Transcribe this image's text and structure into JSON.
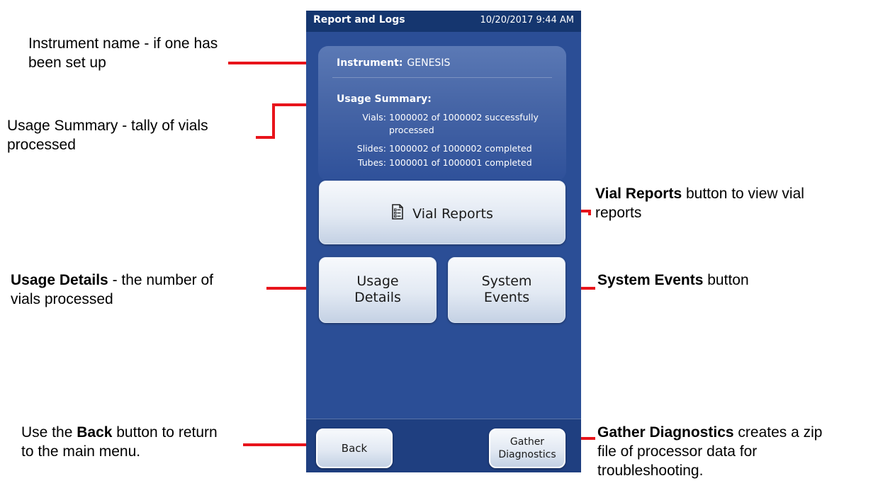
{
  "device": {
    "window_title": "Report and Logs",
    "datetime": "10/20/2017 9:44 AM",
    "instrument_label": "Instrument:",
    "instrument_name": "GENESIS",
    "usage_summary_label": "Usage Summary:",
    "usage": {
      "vials_key": "Vials:",
      "vials_line1": "1000002 of 1000002 successfully",
      "vials_line2": "processed",
      "slides_key": "Slides:",
      "slides_value": "1000002 of 1000002 completed",
      "tubes_key": "Tubes:",
      "tubes_value": "1000001 of 1000001 completed"
    },
    "buttons": {
      "vial_reports": "Vial Reports",
      "usage_line1": "Usage",
      "usage_line2": "Details",
      "system_line1": "System",
      "system_line2": "Events",
      "back": "Back",
      "gather_line1": "Gather",
      "gather_line2": "Diagnostics"
    },
    "icons": {
      "vial_reports": "report-list-icon"
    },
    "colors": {
      "screen_bg": "#2b4e96",
      "title_bar": "#15366f",
      "callout_line": "#e8141b"
    }
  },
  "callouts": {
    "instrument_line1": "Instrument name - if one has",
    "instrument_line2": "been set up",
    "usage_summary_line1": "Usage Summary - tally of vials",
    "usage_summary_line2": "processed",
    "vial_reports_bold": "Vial Reports",
    "vial_reports_rest1": " button to view vial",
    "vial_reports_line2": "reports",
    "usage_details_bold": "Usage Details",
    "usage_details_rest1": " - the number of",
    "usage_details_line2": "vials processed",
    "system_events_bold": "System Events",
    "system_events_rest": " button",
    "back_pre": "Use the ",
    "back_bold": "Back",
    "back_rest1": " button to return",
    "back_line2": "to the main menu.",
    "gather_bold": "Gather Diagnostics",
    "gather_rest1": " creates a zip",
    "gather_line2": "file of processor data for",
    "gather_line3": "troubleshooting."
  }
}
